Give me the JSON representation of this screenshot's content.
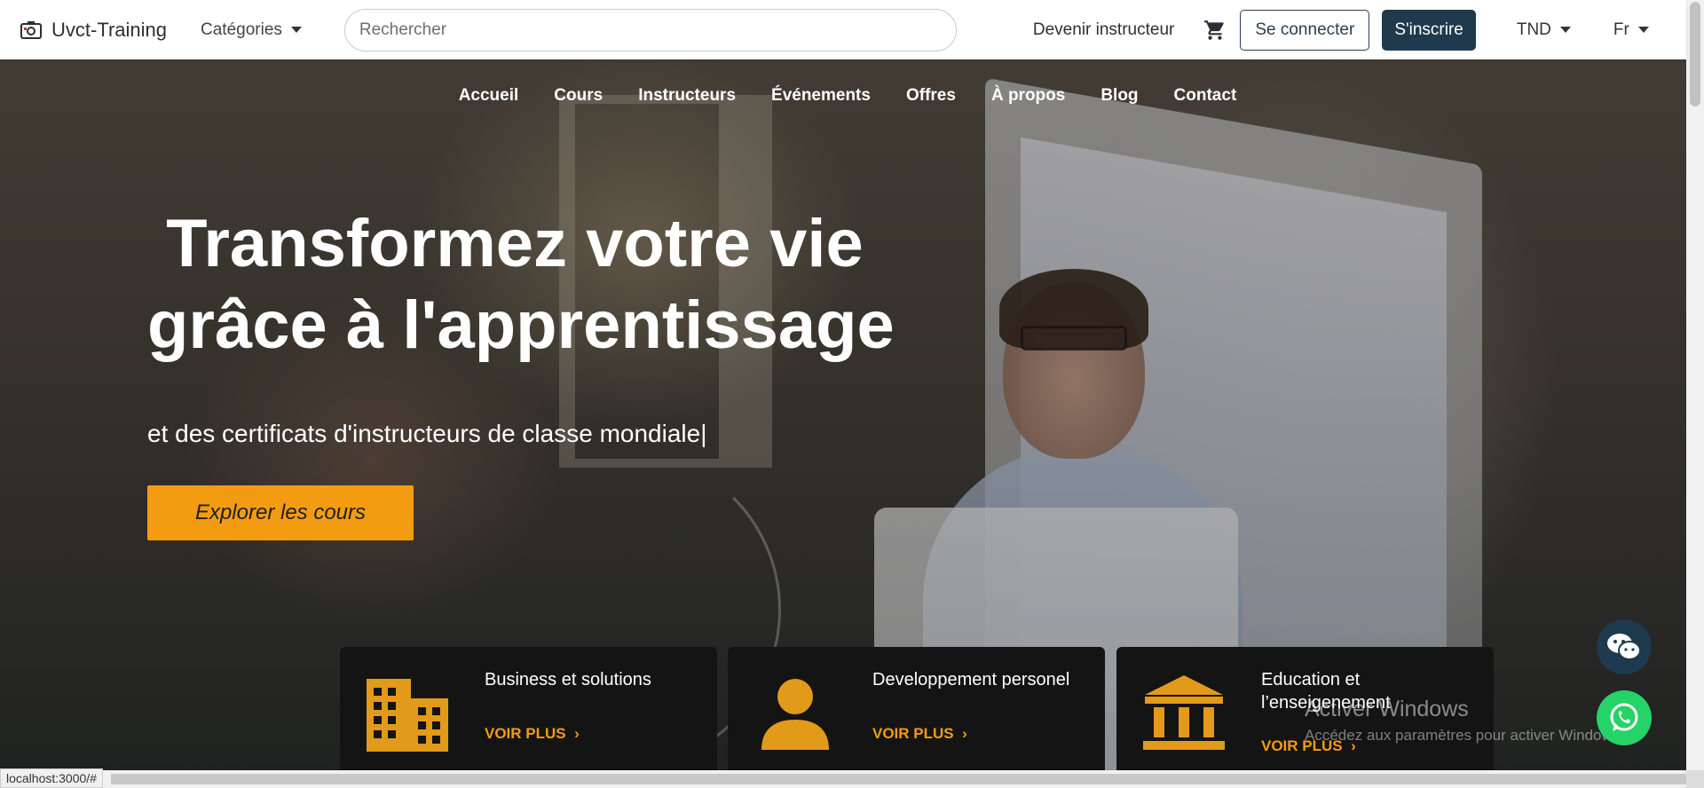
{
  "header": {
    "brand": "Uvct-Training",
    "categories_label": "Catégories",
    "search_placeholder": "Rechercher",
    "become_instructor": "Devenir instructeur",
    "login_label": "Se connecter",
    "signup_label": "S'inscrire",
    "currency": "TND",
    "language": "Fr"
  },
  "nav": {
    "items": [
      "Accueil",
      "Cours",
      "Instructeurs",
      "Événements",
      "Offres",
      "À propos",
      "Blog",
      "Contact"
    ]
  },
  "hero": {
    "title_line1": " Transformez votre vie",
    "title_line2": "grâce à l'apprentissage",
    "subtitle": "et des certificats d'instructeurs de classe mondiale",
    "cursor": "|",
    "cta_label": "Explorer les cours"
  },
  "cards": [
    {
      "title": "Business et solutions",
      "link": "VOIR PLUS",
      "icon": "building-icon"
    },
    {
      "title": "Developpement personel",
      "link": "VOIR PLUS",
      "icon": "person-icon"
    },
    {
      "title": "Education et l’enseigenement",
      "link": "VOIR PLUS",
      "icon": "institution-icon"
    }
  ],
  "windows_watermark": {
    "title": "Activer Windows",
    "subtitle": "Accédez aux paramètres pour activer Windows."
  },
  "status_url": "localhost:3000/#",
  "colors": {
    "accent": "#f39c12",
    "primary": "#1f3a4d",
    "whatsapp": "#25d366",
    "card_bg": "#141414"
  }
}
